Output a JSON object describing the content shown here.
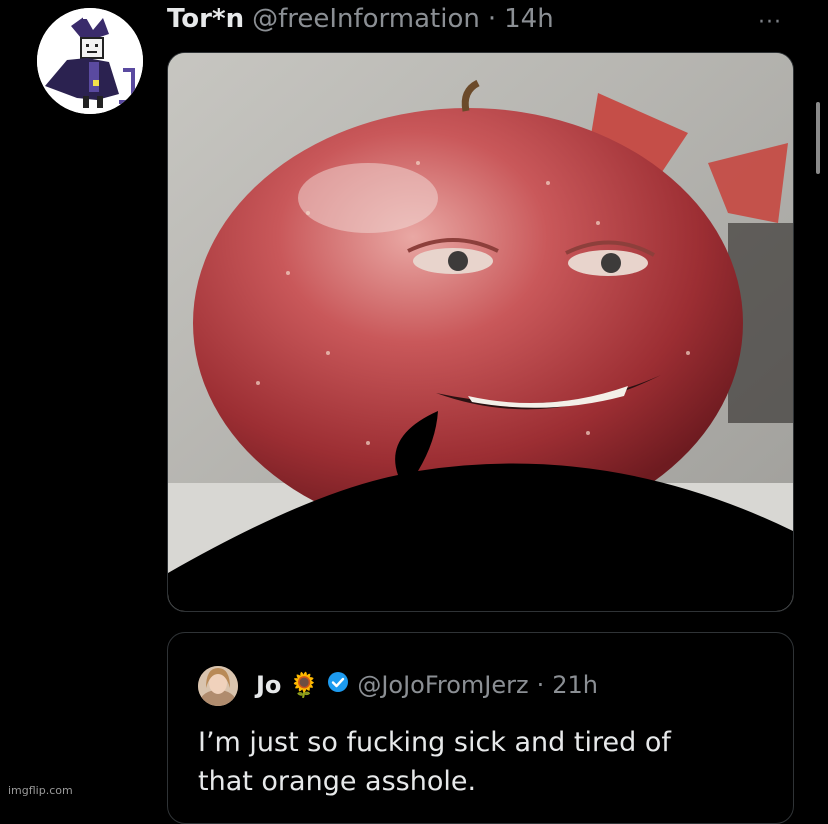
{
  "tweet": {
    "display_name": "Tor*n",
    "handle": "@freeInformation",
    "separator": "·",
    "time": "14h",
    "more_label": "···",
    "avatar_icon": "jester-pixel-avatar-icon",
    "media_description_icon": "apple-with-face-image"
  },
  "quote": {
    "display_name": "Jo",
    "emoji": "🌻",
    "verified_icon": "verified-badge-icon",
    "handle": "@JoJoFromJerz",
    "separator": "·",
    "time": "21h",
    "text_line1": "I’m just so fucking sick and tired of",
    "text_line2": "that orange asshole."
  },
  "watermark": "imgflip.com",
  "colors": {
    "background": "#000000",
    "name": "#e7e9ea",
    "secondary": "#8b8f94",
    "verified": "#1d9bf0",
    "border": "#2f3336"
  }
}
